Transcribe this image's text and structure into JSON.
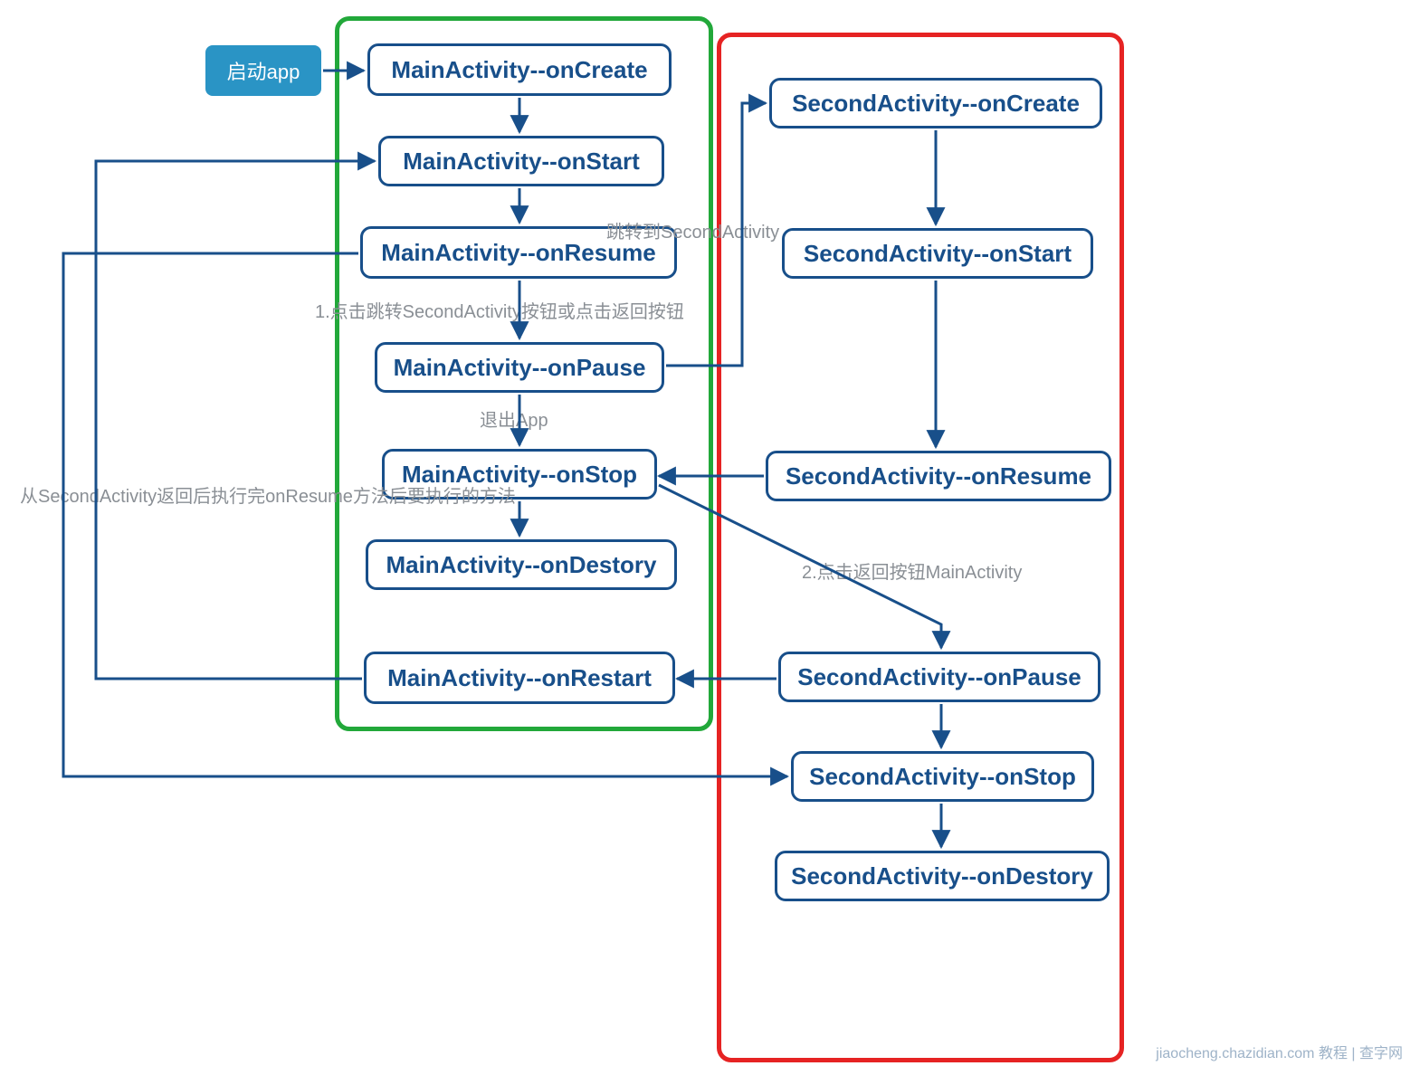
{
  "start": {
    "label": "启动app"
  },
  "main": {
    "onCreate": "MainActivity--onCreate",
    "onStart": "MainActivity--onStart",
    "onResume": "MainActivity--onResume",
    "onPause": "MainActivity--onPause",
    "onStop": "MainActivity--onStop",
    "onDestory": "MainActivity--onDestory",
    "onRestart": "MainActivity--onRestart"
  },
  "second": {
    "onCreate": "SecondActivity--onCreate",
    "onStart": "SecondActivity--onStart",
    "onResume": "SecondActivity--onResume",
    "onPause": "SecondActivity--onPause",
    "onStop": "SecondActivity--onStop",
    "onDestory": "SecondActivity--onDestory"
  },
  "annotations": {
    "jumpTo": "跳转到SecondActivity",
    "click1": "1.点击跳转SecondActivity按钮或点击返回按钮",
    "exitApp": "退出App",
    "back2": "2.点击返回按钮MainActivity",
    "loopNote": "从SecondActivity返回后执行完onResume方法后要执行的方法"
  },
  "footer": "jiaocheng.chazidian.com 教程 | 查字网"
}
